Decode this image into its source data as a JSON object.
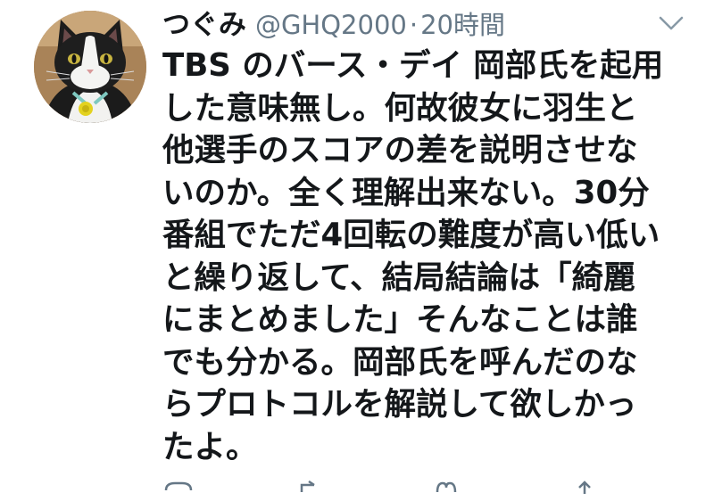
{
  "tweet": {
    "author": {
      "display_name": "つぐみ",
      "handle": "@GHQ2000",
      "avatar_icon": "cat-avatar-icon"
    },
    "separator": "·",
    "timestamp": "20時間",
    "menu_icon": "chevron-down-icon",
    "text_lines": [
      "TBS のバース・デイ 岡部氏を起用",
      "した意味無し。何故彼女に羽生と",
      "他選手のスコアの差を説明させな",
      "いのか。全く理解出来ない。30分",
      "番組でただ4回転の難度が高い低い",
      "と繰り返して、結局結論は「綺麗",
      "にまとめました」そんなことは誰",
      "でも分かる。岡部氏を呼んだのな",
      "らプロトコルを解説して欲しかっ",
      "たよ。"
    ],
    "action_icons": [
      "reply-icon",
      "retweet-icon",
      "like-icon",
      "share-icon"
    ]
  },
  "colors": {
    "text_primary": "#14171a",
    "text_secondary": "#657786",
    "background": "#ffffff"
  }
}
